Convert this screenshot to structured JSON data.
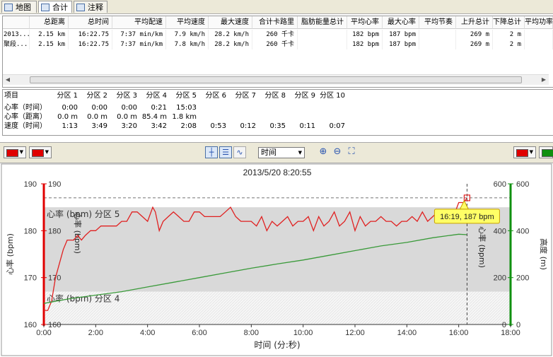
{
  "tabs": [
    {
      "label": "地图",
      "icon": "map-icon"
    },
    {
      "label": "合计",
      "icon": "table-icon",
      "active": true
    },
    {
      "label": "注释",
      "icon": "note-icon"
    }
  ],
  "summary": {
    "headers": [
      "",
      "总距离",
      "总时间",
      "平均配速",
      "平均速度",
      "最大速度",
      "合计卡路里",
      "脂肪能量总计",
      "平均心率",
      "最大心率",
      "平均节奏",
      "上升总计",
      "下降总计",
      "平均功率"
    ],
    "rows": [
      [
        "2013...",
        "2.15 km",
        "16:22.75",
        "7:37 min/km",
        "7.9 km/h",
        "28.2 km/h",
        "260 千卡",
        "",
        "182 bpm",
        "187 bpm",
        "",
        "269 m",
        "2 m",
        ""
      ],
      [
        "聚段...",
        "2.15 km",
        "16:22.75",
        "7:37 min/km",
        "7.8 km/h",
        "28.2 km/h",
        "260 千卡",
        "",
        "182 bpm",
        "187 bpm",
        "",
        "269 m",
        "2 m",
        ""
      ]
    ]
  },
  "zones": {
    "headers": [
      "项目",
      "分区 1",
      "分区 2",
      "分区 3",
      "分区 4",
      "分区 5",
      "分区 6",
      "分区 7",
      "分区 8",
      "分区 9",
      "分区 10"
    ],
    "rows": [
      [
        "心率（时间）",
        "0:00",
        "0:00",
        "0:00",
        "0:21",
        "15:03",
        "",
        "",
        "",
        "",
        ""
      ],
      [
        "心率（距离）",
        "0.0 m",
        "0.0 m",
        "0.0 m",
        "85.4 m",
        "1.8 km",
        "",
        "",
        "",
        "",
        ""
      ],
      [
        "速度（时间）",
        "1:13",
        "3:49",
        "3:20",
        "3:42",
        "2:08",
        "0:53",
        "0:12",
        "0:35",
        "0:11",
        "0:07"
      ]
    ]
  },
  "toolbar": {
    "xaxis_select": "时间",
    "color_left1": "#e00000",
    "color_left2": "#e00000",
    "color_right1": "#e00000",
    "color_right2": "#109010"
  },
  "chart_data": {
    "type": "line",
    "title": "2013/5/20 8:20:55",
    "xlabel": "时间 (分:秒)",
    "ylabel_left": "心率 (bpm)",
    "ylabel_right": "高度 (m)",
    "inner_label_left": "心率 (bpm)",
    "inner_label_right": "心率 (bpm)",
    "xlim": [
      0,
      18
    ],
    "xticks": [
      "0:00",
      "2:00",
      "4:00",
      "6:00",
      "8:00",
      "10:00",
      "12:00",
      "14:00",
      "16:00",
      "18:00"
    ],
    "ylim_left": [
      160,
      190
    ],
    "yticks_left": [
      160,
      170,
      180,
      190
    ],
    "ylim_right": [
      0,
      600
    ],
    "yticks_right": [
      0,
      200,
      400,
      600
    ],
    "zones": [
      {
        "label": "心率 (bpm) 分区 5",
        "from": 167,
        "to": 185
      },
      {
        "label": "心率 (bpm) 分区 4",
        "from": 160,
        "to": 167
      }
    ],
    "marker": {
      "x": 16.32,
      "y": 187,
      "label": "16:19, 187 bpm"
    },
    "series": [
      {
        "color": "#e02020",
        "axis": "left",
        "x": [
          0,
          0.15,
          0.3,
          0.45,
          0.6,
          0.75,
          0.9,
          1.0,
          1.15,
          1.3,
          1.45,
          1.6,
          1.8,
          2.0,
          2.2,
          2.5,
          2.8,
          3.0,
          3.2,
          3.4,
          3.6,
          3.8,
          4.0,
          4.2,
          4.3,
          4.45,
          4.6,
          4.8,
          5.0,
          5.2,
          5.4,
          5.6,
          5.8,
          6.0,
          6.2,
          6.5,
          6.8,
          7.0,
          7.2,
          7.4,
          7.6,
          7.8,
          8.0,
          8.2,
          8.4,
          8.6,
          8.8,
          9.0,
          9.2,
          9.4,
          9.6,
          9.8,
          10.0,
          10.2,
          10.4,
          10.6,
          10.8,
          11.0,
          11.2,
          11.4,
          11.6,
          11.8,
          12.0,
          12.2,
          12.4,
          12.6,
          12.8,
          13.0,
          13.2,
          13.4,
          13.6,
          13.8,
          14.0,
          14.2,
          14.4,
          14.6,
          14.8,
          15.0,
          15.2,
          15.4,
          15.6,
          15.8,
          16.0,
          16.2,
          16.32
        ],
        "y": [
          163,
          163,
          165,
          170,
          173,
          176,
          178,
          178,
          178,
          179,
          178,
          179,
          180,
          180,
          181,
          181,
          181,
          182,
          182,
          184,
          184,
          183,
          182,
          185,
          184,
          180,
          182,
          183,
          184,
          183,
          182,
          182,
          184,
          184,
          183,
          183,
          183,
          184,
          185,
          183,
          182,
          182,
          182,
          181,
          183,
          180,
          182,
          181,
          182,
          183,
          181,
          182,
          182,
          183,
          180,
          183,
          181,
          182,
          184,
          181,
          182,
          184,
          180,
          183,
          181,
          182,
          182,
          183,
          182,
          182,
          181,
          182,
          182,
          183,
          182,
          184,
          182,
          183,
          184,
          182,
          184,
          183,
          186,
          186,
          187
        ]
      },
      {
        "color": "#3a9a3a",
        "axis": "right",
        "x": [
          0,
          1,
          2,
          3,
          4,
          5,
          6,
          7,
          8,
          9,
          10,
          11,
          12,
          13,
          14,
          15,
          16,
          16.32
        ],
        "y": [
          90,
          110,
          125,
          140,
          160,
          180,
          200,
          220,
          240,
          258,
          275,
          295,
          315,
          335,
          350,
          370,
          385,
          383
        ]
      }
    ]
  }
}
